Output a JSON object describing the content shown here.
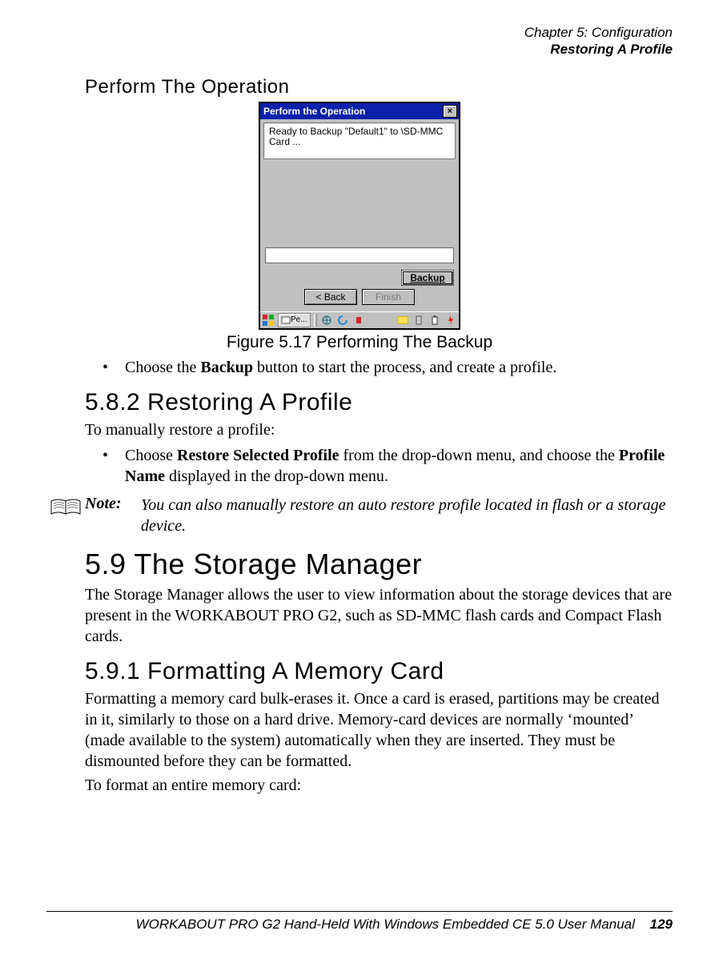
{
  "header": {
    "chapter": "Chapter 5: Configuration",
    "section": "Restoring A Profile"
  },
  "headings": {
    "perform_op": "Perform The Operation",
    "sec_582": "5.8.2   Restoring A Profile",
    "sec_59": "5.9   The Storage Manager",
    "sec_591": "5.9.1   Formatting A Memory Card"
  },
  "figure": {
    "caption": "Figure 5.17 Performing The Backup",
    "dialog": {
      "title": "Perform the Operation",
      "close_label": "×",
      "message": "Ready to Backup \"Default1\" to \\SD-MMC Card ...",
      "backup_btn": "Backup",
      "back_btn": "<  Back",
      "finish_btn": "Finish",
      "task_label": "Pe..."
    }
  },
  "bullets": {
    "b1_pre": "Choose the ",
    "b1_bold": "Backup",
    "b1_post": " button to start the process, and create a profile.",
    "b2_pre": "Choose ",
    "b2_bold1": "Restore Selected Profile",
    "b2_mid": " from the drop-down menu, and choose the ",
    "b2_bold2": "Profile Name",
    "b2_post": " displayed in the drop-down menu."
  },
  "paragraphs": {
    "p1": "To manually restore a profile:",
    "note_label": "Note:",
    "note_text": "You can also manually restore an auto restore profile located in flash or a storage device.",
    "p59": "The Storage Manager allows the user to view information about the storage devices that are present in the WORKABOUT PRO G2, such as SD-MMC flash cards and Compact Flash cards.",
    "p591a": "Formatting a memory card bulk-erases it. Once a card is erased, partitions may be created in it, similarly to those on a hard drive. Memory-card devices are normally ‘mounted’ (made available to the system) automatically when they are inserted. They must be dismounted before they can be formatted.",
    "p591b": "To format an entire memory card:"
  },
  "footer": {
    "text": "WORKABOUT PRO G2 Hand-Held With Windows Embedded CE 5.0 User Manual",
    "page": "129"
  }
}
